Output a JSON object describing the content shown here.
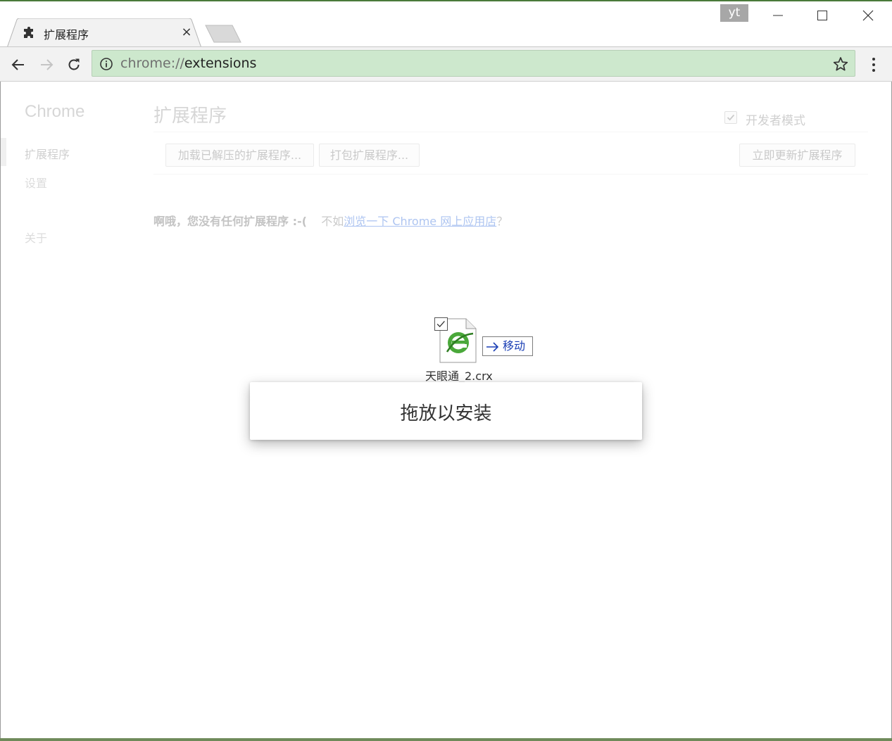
{
  "window": {
    "profile_initials": "yt"
  },
  "tab": {
    "title": "扩展程序",
    "close_glyph": "×"
  },
  "omnibox": {
    "url_scheme": "chrome://",
    "url_path": "extensions"
  },
  "sidebar": {
    "title": "Chrome",
    "items": [
      {
        "label": "扩展程序"
      },
      {
        "label": "设置"
      },
      {
        "label": "关于"
      }
    ]
  },
  "main": {
    "title": "扩展程序",
    "developer_mode_label": "开发者模式",
    "buttons": {
      "load_unpacked": "加载已解压的扩展程序...",
      "pack": "打包扩展程序...",
      "update_now": "立即更新扩展程序"
    },
    "empty": {
      "bold": "啊哦，您没有任何扩展程序 :-(",
      "prefix": "不如",
      "link": "浏览一下 Chrome 网上应用店",
      "suffix": "？"
    }
  },
  "drag": {
    "move_label": "移动",
    "file_name": "天眼通_2.crx"
  },
  "drop_overlay": {
    "message": "拖放以安装"
  },
  "colors": {
    "omnibox_bg": "#cde8cd",
    "link": "#1558d6",
    "move_text": "#1a3fb5",
    "file_icon_green": "#4aa83a"
  }
}
